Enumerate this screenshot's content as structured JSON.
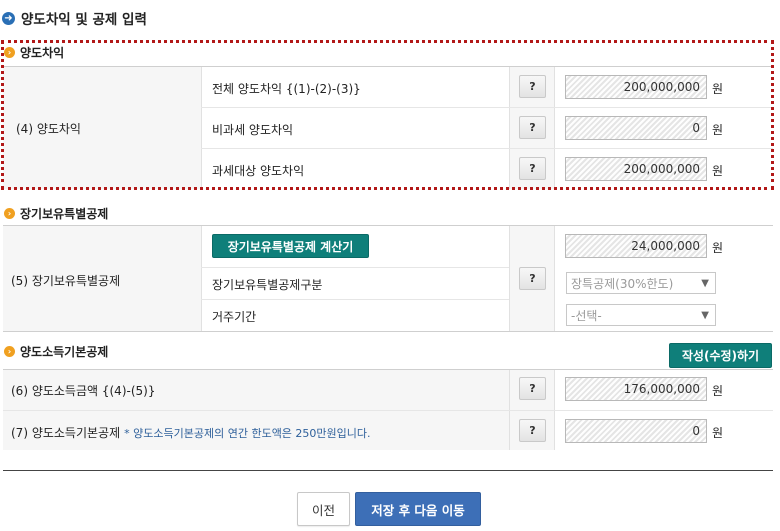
{
  "page_title": "양도차익 및 공제 입력",
  "unit": "원",
  "help_label": "?",
  "sections": {
    "gain": {
      "header": "양도차익",
      "row_label": "(4) 양도차익",
      "rows": [
        {
          "label": "전체 양도차익 {(1)-(2)-(3)}",
          "value": "200,000,000"
        },
        {
          "label": "비과세 양도차익",
          "value": "0"
        },
        {
          "label": "과세대상 양도차익",
          "value": "200,000,000"
        }
      ]
    },
    "longterm": {
      "header": "장기보유특별공제",
      "row_label": "(5) 장기보유특별공제",
      "calc_button": "장기보유특별공제 계산기",
      "value": "24,000,000",
      "type_label": "장기보유특별공제구분",
      "type_value": "장특공제(30%한도)",
      "period_label": "거주기간",
      "period_value": "-선택-"
    },
    "basic": {
      "header": "양도소득기본공제",
      "edit_button": "작성(수정)하기",
      "income_label": "(6) 양도소득금액 {(4)-(5)}",
      "income_value": "176,000,000",
      "deduction_label": "(7) 양도소득기본공제",
      "deduction_note": "* 양도소득기본공제의 연간 한도액은 250만원입니다.",
      "deduction_value": "0"
    }
  },
  "footer": {
    "prev_button": "이전",
    "next_button": "저장 후 다음 이동"
  },
  "colors": {
    "title_icon": "#2a6fb5",
    "section_icon": "#f0a020",
    "dotted_border": "#b21818",
    "teal_button": "#0f7f7a",
    "primary_button": "#3d6fb7"
  }
}
